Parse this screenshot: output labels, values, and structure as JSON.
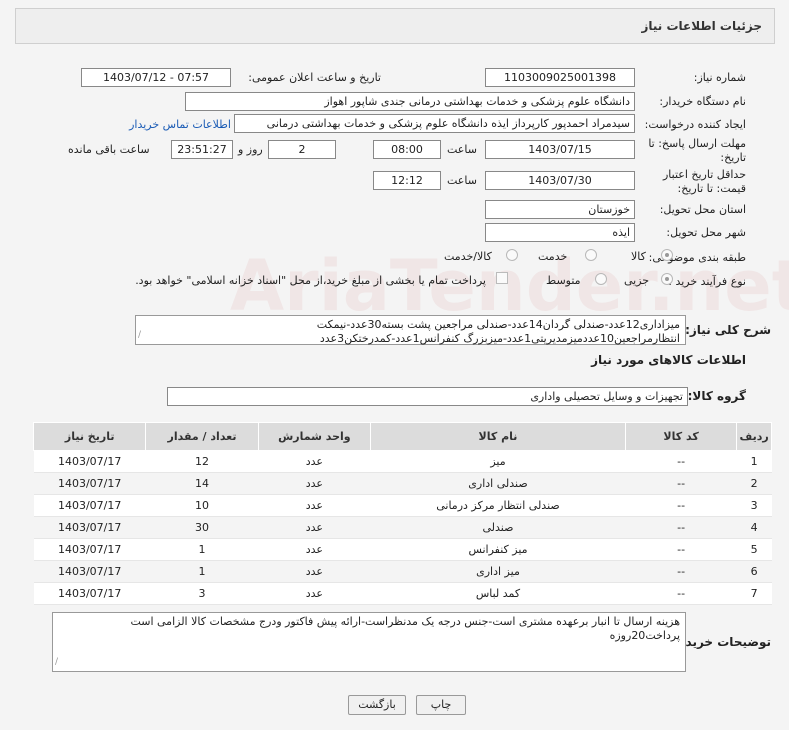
{
  "header": {
    "title": "جزئیات اطلاعات نیاز"
  },
  "fields": {
    "need_number_label": "شماره نیاز:",
    "need_number": "1103009025001398",
    "announce_label": "تاریخ و ساعت اعلان عمومی:",
    "announce_value": "1403/07/12 - 07:57",
    "buyer_org_label": "نام دستگاه خریدار:",
    "buyer_org": "دانشگاه علوم پزشکی و خدمات بهداشتی درمانی جندی شاپور اهواز",
    "creator_label": "ایجاد کننده درخواست:",
    "creator": "سیدمراد احمدپور کارپرداز ایذه دانشگاه علوم پزشکی و خدمات بهداشتی درمانی",
    "contact_link": "اطلاعات تماس خریدار",
    "send_deadline_label": "مهلت ارسال پاسخ: تا تاریخ:",
    "send_date": "1403/07/15",
    "time_label": "ساعت",
    "send_time": "08:00",
    "days_value": "2",
    "days_label": "روز و",
    "remaining_time": "23:51:27",
    "remaining_label": "ساعت باقی مانده",
    "validity_label": "حداقل تاریخ اعتبار قیمت: تا تاریخ:",
    "validity_date": "1403/07/30",
    "validity_time": "12:12",
    "province_label": "استان محل تحویل:",
    "province": "خوزستان",
    "city_label": "شهر محل تحویل:",
    "city": "ایذه",
    "category_label": "طبقه بندی موضوعی:",
    "category_options": [
      "کالا",
      "خدمت",
      "کالا/خدمت"
    ],
    "purchase_type_label": "نوع فرآیند خرید :",
    "purchase_options": [
      "جزیی",
      "متوسط"
    ],
    "payment_note": "پرداخت تمام یا بخشی از مبلغ خرید،از محل \"اسناد خزانه اسلامی\" خواهد بود.",
    "summary_label": "شرح کلی نیاز:",
    "summary": "میزاداری12عدد-صندلی گردان14عدد-صندلی مراجعین پشت بسته30عدد-نیمکت انتظارمراجعین10عددمیزمدیریتی1عدد-میزبزرگ کنفرانس1عدد-کمدرختکن3عدد",
    "goods_info_title": "اطلاعات کالاهای مورد نیاز",
    "goods_group_label": "گروه کالا:",
    "goods_group": "تجهیزات و وسایل تحصیلی واداری"
  },
  "table": {
    "headers": [
      "ردیف",
      "کد کالا",
      "نام کالا",
      "واحد شمارش",
      "تعداد / مقدار",
      "تاریخ نیاز"
    ],
    "rows": [
      [
        "1",
        "--",
        "میز",
        "عدد",
        "12",
        "1403/07/17"
      ],
      [
        "2",
        "--",
        "صندلی اداری",
        "عدد",
        "14",
        "1403/07/17"
      ],
      [
        "3",
        "--",
        "صندلی انتظار مرکز درمانی",
        "عدد",
        "10",
        "1403/07/17"
      ],
      [
        "4",
        "--",
        "صندلی",
        "عدد",
        "30",
        "1403/07/17"
      ],
      [
        "5",
        "--",
        "میز کنفرانس",
        "عدد",
        "1",
        "1403/07/17"
      ],
      [
        "6",
        "--",
        "میز اداری",
        "عدد",
        "1",
        "1403/07/17"
      ],
      [
        "7",
        "--",
        "کمد لباس",
        "عدد",
        "3",
        "1403/07/17"
      ]
    ]
  },
  "buyer_notes": {
    "label": "توضیحات خریدار:",
    "text": "هزینه ارسال تا انبار برعهده مشتری است-جنس درجه یک مدنظراست-ارائه پیش فاکتور ودرج مشخصات کالا الزامی است پرداخت20روزه"
  },
  "buttons": {
    "print": "چاپ",
    "back": "بازگشت"
  },
  "watermark_text": "AriaTender.net"
}
